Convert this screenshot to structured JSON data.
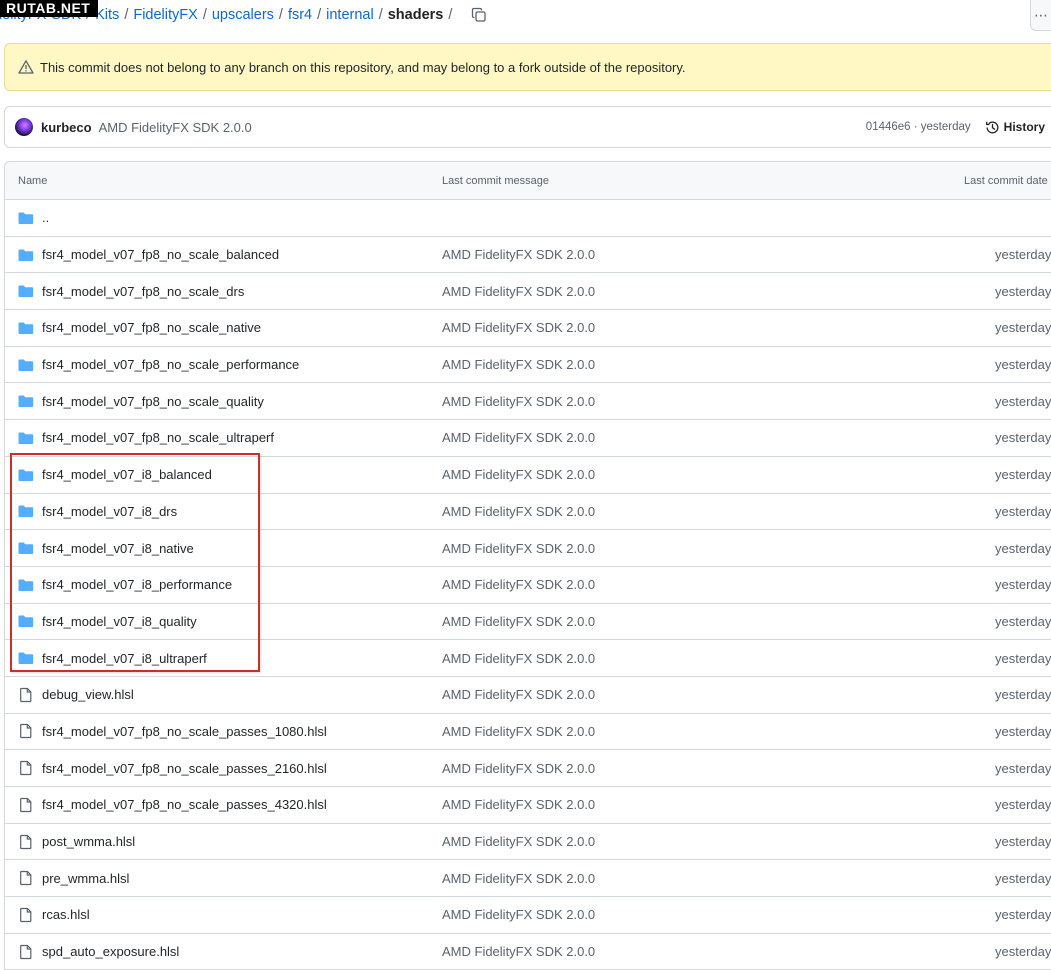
{
  "watermark": "RUTAB.NET",
  "breadcrumb": {
    "items": [
      "FidelityFX-SDK",
      "Kits",
      "FidelityFX",
      "upscalers",
      "fsr4",
      "internal"
    ],
    "current": "shaders",
    "separator": "/"
  },
  "flash": {
    "icon": "alert-icon",
    "text": "This commit does not belong to any branch on this repository, and may belong to a fork outside of the repository."
  },
  "commit": {
    "author": "kurbeco",
    "message": "AMD FidelityFX SDK 2.0.0",
    "hash_time": "01446e6 · yesterday",
    "history_label": "History"
  },
  "table": {
    "headers": {
      "name": "Name",
      "message": "Last commit message",
      "date": "Last commit date"
    },
    "parent_row": "..",
    "rows": [
      {
        "type": "folder",
        "name": "fsr4_model_v07_fp8_no_scale_balanced",
        "message": "AMD FidelityFX SDK 2.0.0",
        "date": "yesterday"
      },
      {
        "type": "folder",
        "name": "fsr4_model_v07_fp8_no_scale_drs",
        "message": "AMD FidelityFX SDK 2.0.0",
        "date": "yesterday"
      },
      {
        "type": "folder",
        "name": "fsr4_model_v07_fp8_no_scale_native",
        "message": "AMD FidelityFX SDK 2.0.0",
        "date": "yesterday"
      },
      {
        "type": "folder",
        "name": "fsr4_model_v07_fp8_no_scale_performance",
        "message": "AMD FidelityFX SDK 2.0.0",
        "date": "yesterday"
      },
      {
        "type": "folder",
        "name": "fsr4_model_v07_fp8_no_scale_quality",
        "message": "AMD FidelityFX SDK 2.0.0",
        "date": "yesterday"
      },
      {
        "type": "folder",
        "name": "fsr4_model_v07_fp8_no_scale_ultraperf",
        "message": "AMD FidelityFX SDK 2.0.0",
        "date": "yesterday"
      },
      {
        "type": "folder",
        "name": "fsr4_model_v07_i8_balanced",
        "message": "AMD FidelityFX SDK 2.0.0",
        "date": "yesterday"
      },
      {
        "type": "folder",
        "name": "fsr4_model_v07_i8_drs",
        "message": "AMD FidelityFX SDK 2.0.0",
        "date": "yesterday"
      },
      {
        "type": "folder",
        "name": "fsr4_model_v07_i8_native",
        "message": "AMD FidelityFX SDK 2.0.0",
        "date": "yesterday"
      },
      {
        "type": "folder",
        "name": "fsr4_model_v07_i8_performance",
        "message": "AMD FidelityFX SDK 2.0.0",
        "date": "yesterday"
      },
      {
        "type": "folder",
        "name": "fsr4_model_v07_i8_quality",
        "message": "AMD FidelityFX SDK 2.0.0",
        "date": "yesterday"
      },
      {
        "type": "folder",
        "name": "fsr4_model_v07_i8_ultraperf",
        "message": "AMD FidelityFX SDK 2.0.0",
        "date": "yesterday"
      },
      {
        "type": "file",
        "name": "debug_view.hlsl",
        "message": "AMD FidelityFX SDK 2.0.0",
        "date": "yesterday"
      },
      {
        "type": "file",
        "name": "fsr4_model_v07_fp8_no_scale_passes_1080.hlsl",
        "message": "AMD FidelityFX SDK 2.0.0",
        "date": "yesterday"
      },
      {
        "type": "file",
        "name": "fsr4_model_v07_fp8_no_scale_passes_2160.hlsl",
        "message": "AMD FidelityFX SDK 2.0.0",
        "date": "yesterday"
      },
      {
        "type": "file",
        "name": "fsr4_model_v07_fp8_no_scale_passes_4320.hlsl",
        "message": "AMD FidelityFX SDK 2.0.0",
        "date": "yesterday"
      },
      {
        "type": "file",
        "name": "post_wmma.hlsl",
        "message": "AMD FidelityFX SDK 2.0.0",
        "date": "yesterday"
      },
      {
        "type": "file",
        "name": "pre_wmma.hlsl",
        "message": "AMD FidelityFX SDK 2.0.0",
        "date": "yesterday"
      },
      {
        "type": "file",
        "name": "rcas.hlsl",
        "message": "AMD FidelityFX SDK 2.0.0",
        "date": "yesterday"
      },
      {
        "type": "file",
        "name": "spd_auto_exposure.hlsl",
        "message": "AMD FidelityFX SDK 2.0.0",
        "date": "yesterday"
      }
    ]
  },
  "colors": {
    "link": "#0969da",
    "folder_icon": "#54aeff",
    "flash_bg": "#fff8c5",
    "highlight_box": "#c9302c"
  }
}
